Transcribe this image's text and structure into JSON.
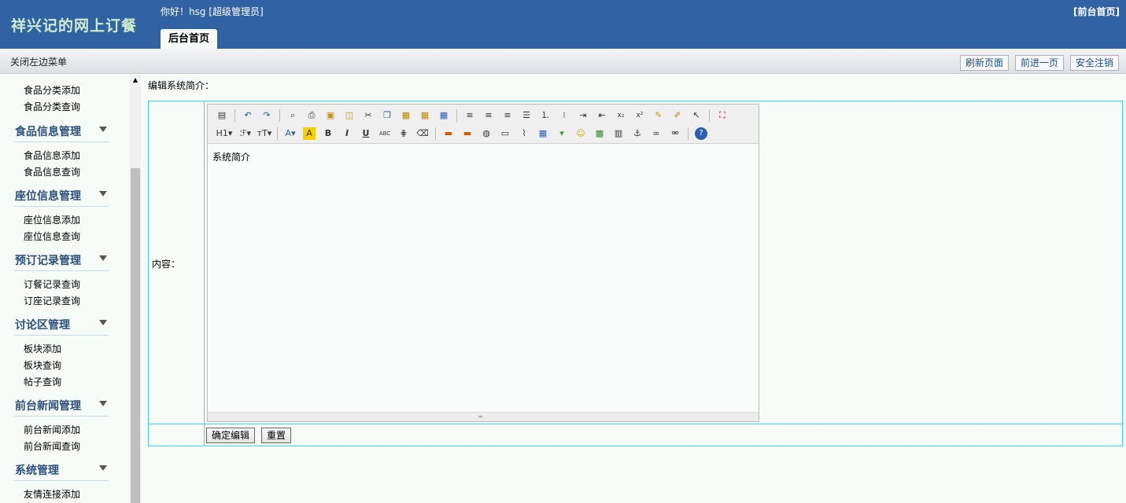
{
  "header": {
    "app_title": "祥兴记的网上订餐",
    "greeting": "你好！hsg [超级管理员]",
    "front_link": "[前台首页]",
    "tab_label": "后台首页",
    "background_color": "#3163a3"
  },
  "subbar": {
    "close_menu": "关闭左边菜单",
    "refresh": "刷新页面",
    "forward": "前进一页",
    "logout": "安全注销"
  },
  "sidebar": {
    "top_items": [
      "食品分类添加",
      "食品分类查询"
    ],
    "groups": [
      {
        "title": "食品信息管理",
        "items": [
          "食品信息添加",
          "食品信息查询"
        ]
      },
      {
        "title": "座位信息管理",
        "items": [
          "座位信息添加",
          "座位信息查询"
        ]
      },
      {
        "title": "预订记录管理",
        "items": [
          "订餐记录查询",
          "订座记录查询"
        ]
      },
      {
        "title": "讨论区管理",
        "items": [
          "板块添加",
          "板块查询",
          "帖子查询"
        ]
      },
      {
        "title": "前台新闻管理",
        "items": [
          "前台新闻添加",
          "前台新闻查询"
        ]
      },
      {
        "title": "系统管理",
        "items": [
          "友情连接添加"
        ]
      }
    ]
  },
  "content": {
    "heading": "编辑系统简介：",
    "label": "内容：",
    "editor_text": "系统简介",
    "submit": "确定编辑",
    "reset": "重置",
    "border_color": "#3bd8e8"
  },
  "toolbar_icons": {
    "row1": [
      "source-icon",
      "sep",
      "undo-icon",
      "redo-icon",
      "sep",
      "preview-icon",
      "print-icon",
      "template-icon",
      "code-icon",
      "cut-icon",
      "copy-icon",
      "paste-icon",
      "paste-text-icon",
      "paste-word-icon",
      "sep",
      "align-left-icon",
      "align-center-icon",
      "align-right-icon",
      "align-justify-icon",
      "ordered-list-icon",
      "unordered-list-icon",
      "indent-icon",
      "outdent-icon",
      "subscript-icon",
      "superscript-icon",
      "clear-format-icon",
      "select-all-icon",
      "select-icon",
      "sep",
      "fullscreen-icon"
    ],
    "row2": [
      "heading-icon",
      "font-family-icon",
      "font-size-icon",
      "sep",
      "font-color-icon",
      "highlight-icon",
      "bold-icon",
      "italic-icon",
      "underline-icon",
      "strike-icon",
      "line-height-icon",
      "eraser-icon",
      "sep",
      "image-icon",
      "multi-image-icon",
      "flash-icon",
      "media-icon",
      "attachment-icon",
      "table-icon",
      "hr-icon",
      "emoticon-icon",
      "map-icon",
      "page-break-icon",
      "anchor-icon",
      "link-icon",
      "unlink-icon",
      "sep",
      "help-icon"
    ]
  }
}
